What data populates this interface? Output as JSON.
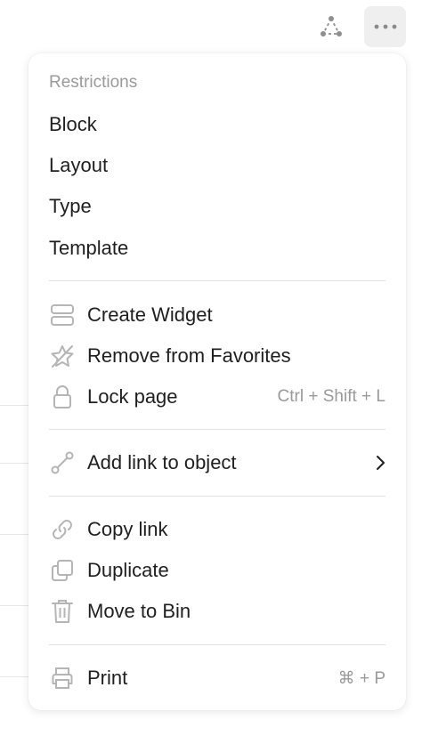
{
  "toolbar": {
    "graph_icon": "graph-icon",
    "more_icon": "more-horizontal-icon"
  },
  "menu": {
    "restrictions_title": "Restrictions",
    "restrictions": [
      {
        "label": "Block"
      },
      {
        "label": "Layout"
      },
      {
        "label": "Type"
      },
      {
        "label": "Template"
      }
    ],
    "create_widget": {
      "label": "Create Widget",
      "icon": "widget-icon"
    },
    "remove_favorites": {
      "label": "Remove from Favorites",
      "icon": "star-off-icon"
    },
    "lock_page": {
      "label": "Lock page",
      "shortcut": "Ctrl + Shift + L",
      "icon": "lock-icon"
    },
    "add_link": {
      "label": "Add link to object",
      "icon": "relation-link-icon",
      "submenu_icon": "chevron-right-icon"
    },
    "copy_link": {
      "label": "Copy link",
      "icon": "link-icon"
    },
    "duplicate": {
      "label": "Duplicate",
      "icon": "duplicate-icon"
    },
    "move_to_bin": {
      "label": "Move to Bin",
      "icon": "trash-icon"
    },
    "print": {
      "label": "Print",
      "shortcut": "⌘ + P",
      "icon": "printer-icon"
    }
  },
  "colors": {
    "text": "#1f1f1f",
    "muted": "#9a9a9a",
    "icon": "#b5b5b5",
    "divider": "#e3e3e3",
    "more_button_bg": "#efefef"
  }
}
